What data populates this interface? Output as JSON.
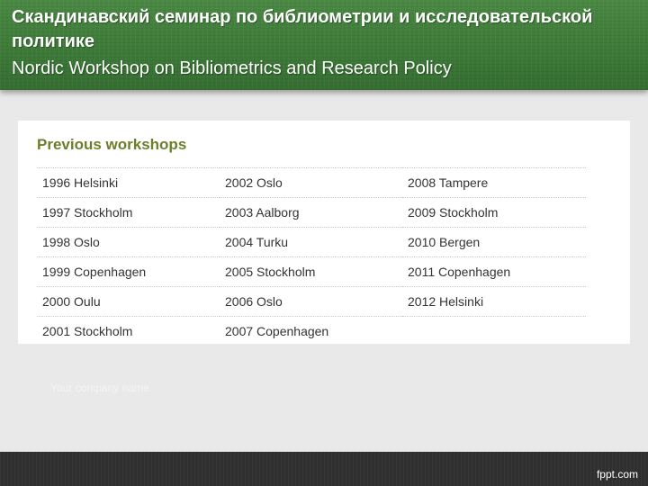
{
  "header": {
    "title_ru": "Скандинавский семинар по библиометрии и исследовательской политике",
    "title_en": "Nordic Workshop on Bibliometrics and Research Policy"
  },
  "panel": {
    "heading": "Previous workshops",
    "rows": [
      [
        "1996 Helsinki",
        "2002 Oslo",
        "2008 Tampere"
      ],
      [
        "1997 Stockholm",
        "2003 Aalborg",
        "2009 Stockholm"
      ],
      [
        "1998 Oslo",
        "2004 Turku",
        "2010 Bergen"
      ],
      [
        "1999 Copenhagen",
        "2005 Stockholm",
        "2011 Copenhagen"
      ],
      [
        "2000 Oulu",
        "2006 Oslo",
        "2012 Helsinki"
      ],
      [
        "2001 Stockholm",
        "2007 Copenhagen",
        ""
      ]
    ]
  },
  "footer": {
    "company_placeholder": "Your company name",
    "brand": "fppt.com"
  },
  "colors": {
    "header_green": "#3f7c3a",
    "heading_olive": "#6b7f2a",
    "footer_dark": "#2f2f2f",
    "background": "#e9e9e9"
  }
}
